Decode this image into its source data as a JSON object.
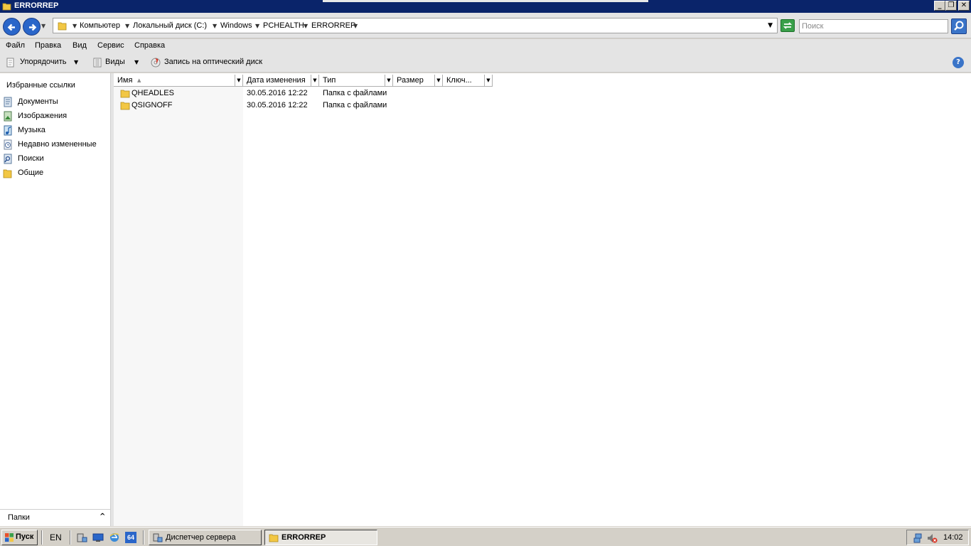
{
  "window": {
    "title": "ERRORREP",
    "minimize": "_",
    "restore": "❐",
    "close": "✕"
  },
  "address": {
    "crumbs": [
      "Компьютер",
      "Локальный диск (C:)",
      "Windows",
      "PCHEALTH",
      "ERRORREP"
    ],
    "search_placeholder": "Поиск"
  },
  "menu": {
    "items": [
      "Файл",
      "Правка",
      "Вид",
      "Сервис",
      "Справка"
    ]
  },
  "toolbar": {
    "organize": "Упорядочить",
    "views": "Виды",
    "burn": "Запись на оптический диск",
    "help": "?"
  },
  "navpane": {
    "header": "Избранные ссылки",
    "links": [
      {
        "label": "Документы",
        "icon": "documents-icon"
      },
      {
        "label": "Изображения",
        "icon": "pictures-icon"
      },
      {
        "label": "Музыка",
        "icon": "music-icon"
      },
      {
        "label": "Недавно измененные",
        "icon": "recent-icon"
      },
      {
        "label": "Поиски",
        "icon": "searches-icon"
      },
      {
        "label": "Общие",
        "icon": "public-icon"
      }
    ],
    "folders": "Папки"
  },
  "filelist": {
    "columns": [
      "Имя",
      "Дата изменения",
      "Тип",
      "Размер",
      "Ключ..."
    ],
    "rows": [
      {
        "name": "QHEADLES",
        "date": "30.05.2016 12:22",
        "type": "Папка с файлами"
      },
      {
        "name": "QSIGNOFF",
        "date": "30.05.2016 12:22",
        "type": "Папка с файлами"
      }
    ]
  },
  "taskbar": {
    "start": "Пуск",
    "lang": "EN",
    "tasks": [
      {
        "label": "Диспетчер сервера",
        "active": false
      },
      {
        "label": "ERRORREP",
        "active": true
      }
    ],
    "clock": "14:02",
    "ql_64": "64"
  },
  "colors": {
    "titlebar": "#0a246a",
    "folder": "#f2c744",
    "nav_button": "#2a66c9"
  }
}
